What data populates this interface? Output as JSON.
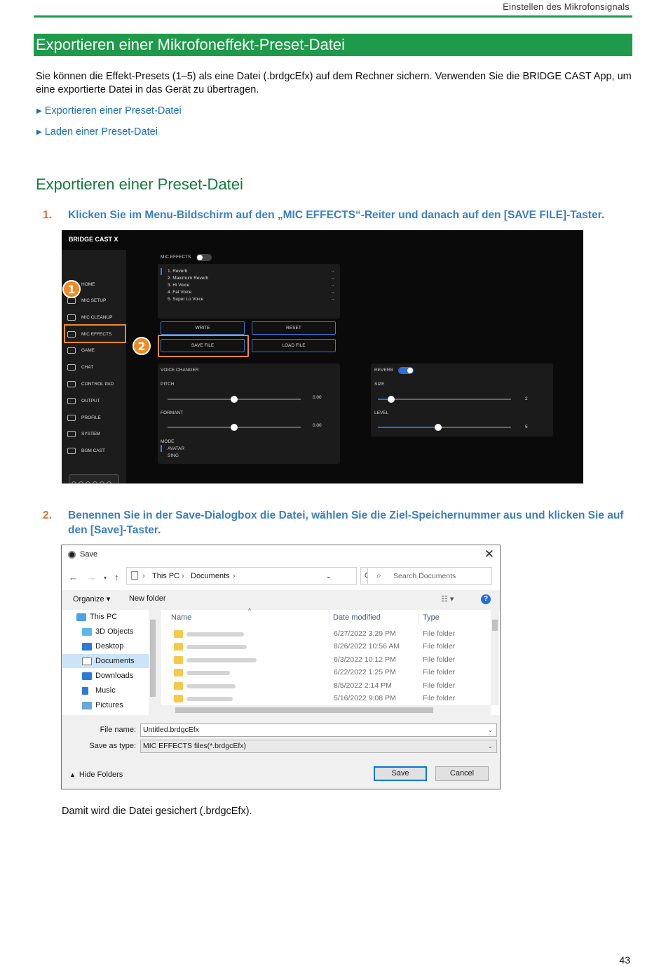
{
  "header": {
    "running_title": "Einstellen des Mikrofonsignals"
  },
  "section": {
    "title": "Exportieren einer Mikrofoneffekt-Preset-Datei"
  },
  "intro": "Sie können die Effekt-Presets (1–5) als eine Datei (.brdgcEfx) auf dem Rechner sichern. Verwenden Sie die BRIDGE CAST App, um eine exportierte Datei in das Gerät zu übertragen.",
  "links": [
    {
      "label": "Exportieren einer Preset-Datei"
    },
    {
      "label": "Laden einer Preset-Datei"
    }
  ],
  "subheading": "Exportieren einer Preset-Datei",
  "steps": [
    {
      "number": "1.",
      "text": "Klicken Sie im Menu-Bildschirm auf den „MIC EFFECTS“-Reiter und danach auf den [SAVE FILE]-Taster."
    },
    {
      "number": "2.",
      "text": "Benennen Sie in der Save-Dialogbox die Datei, wählen Sie die Ziel-Speichernummer aus und klicken Sie auf den [Save]-Taster."
    }
  ],
  "app": {
    "title": "BRIDGE CAST X",
    "nav": [
      "HOME",
      "MIC SETUP",
      "MIC CLEANUP",
      "MIC EFFECTS",
      "GAME",
      "CHAT",
      "CONTROL PAD",
      "OUTPUT",
      "PROFILE",
      "SYSTEM",
      "BGM CAST"
    ],
    "selected_nav": "MIC EFFECTS",
    "mic_effects_label": "MIC EFFECTS",
    "mic_effects_on": false,
    "presets": [
      "1. Reverb",
      "2. Maximum Reverb",
      "3. Hi Voice",
      "4. Fat Voice",
      "5. Super Lo Voice"
    ],
    "preset_arrow": "→",
    "buttons": {
      "write": "WRITE",
      "reset": "RESET",
      "save_file": "SAVE FILE",
      "load_file": "LOAD FILE"
    },
    "voice_changer": {
      "label": "VOICE CHANGER",
      "pitch_label": "PITCH",
      "pitch_value": "0.00",
      "pitch_level": 0.5,
      "formant_label": "FORMANT",
      "formant_value": "0.00",
      "formant_level": 0.5,
      "mode_label": "MODE",
      "modes": [
        "AVATAR",
        "SING"
      ]
    },
    "reverb": {
      "label": "REVERB",
      "on": true,
      "size_label": "SIZE",
      "size_value": "2",
      "size_level": 0.1,
      "level_label": "LEVEL",
      "level_value": "5",
      "level_level": 0.45
    },
    "callouts": [
      "1",
      "2"
    ],
    "accent_color": "#f08a24",
    "ui_blue": "#2f6bdb"
  },
  "dialog": {
    "title": "Save",
    "close": "✕",
    "breadcrumb": [
      "This PC",
      "Documents"
    ],
    "search_placeholder": "Search Documents",
    "organize": "Organize ▾",
    "new_folder": "New folder",
    "help": "?",
    "tree": [
      "This PC",
      "3D Objects",
      "Desktop",
      "Documents",
      "Downloads",
      "Music",
      "Pictures"
    ],
    "selected_tree": "Documents",
    "columns": [
      "Name",
      "Date modified",
      "Type"
    ],
    "files": [
      {
        "date": "6/27/2022 3:29 PM",
        "type": "File folder"
      },
      {
        "date": "8/26/2022 10:56 AM",
        "type": "File folder"
      },
      {
        "date": "6/3/2022 10:12 PM",
        "type": "File folder"
      },
      {
        "date": "6/22/2022 1:25 PM",
        "type": "File folder"
      },
      {
        "date": "8/5/2022 2:14 PM",
        "type": "File folder"
      },
      {
        "date": "5/16/2022 9:08 PM",
        "type": "File folder"
      }
    ],
    "file_name_label": "File name:",
    "file_name_value": "Untitled.brdgcEfx",
    "save_type_label": "Save as type:",
    "save_type_value": "MIC EFFECTS files(*.brdgcEfx)",
    "hide_folders": "Hide Folders",
    "save_button": "Save",
    "cancel_button": "Cancel"
  },
  "result": "Damit wird die Datei gesichert (.brdgcEfx).",
  "page_number": "43",
  "colors": {
    "green": "#1f9a4a",
    "link_blue": "#1a6fb5",
    "step_blue": "#3a7fc1",
    "step_orange": "#e2702c"
  }
}
